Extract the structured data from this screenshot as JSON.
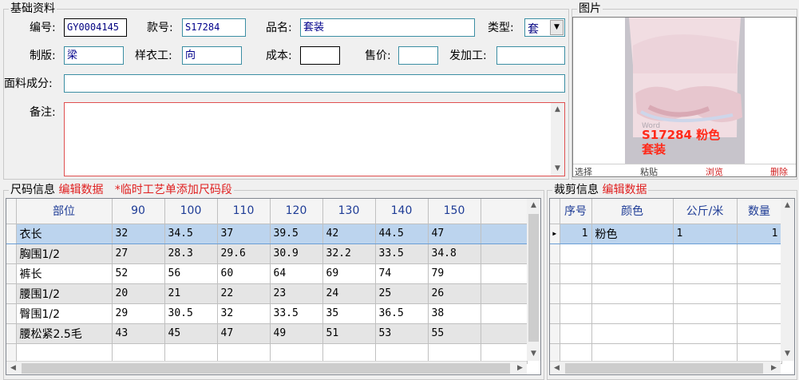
{
  "basic": {
    "title": "基础资料",
    "code_label": "编号:",
    "code_value": "GY0004145",
    "style_label": "款号:",
    "style_value": "S17284",
    "name_label": "品名:",
    "name_value": "套装",
    "type_label": "类型:",
    "type_value": "套",
    "pattern_label": "制版:",
    "pattern_value": "梁",
    "sample_label": "样衣工:",
    "sample_value": "向",
    "cost_label": "成本:",
    "cost_value": "",
    "price_label": "售价:",
    "price_value": "",
    "outsource_label": "发加工:",
    "outsource_value": "",
    "fabric_label": "面料成分:",
    "fabric_value": "",
    "notes_label": "备注:",
    "notes_value": ""
  },
  "picture": {
    "title": "图片",
    "caption_line1": "S17284  粉色",
    "caption_line2": "套装",
    "watermark": "Word",
    "btn_select": "选择",
    "btn_paste": "粘贴",
    "btn_browse": "浏览",
    "btn_delete": "删除"
  },
  "size_info": {
    "title": "尺码信息",
    "edit_link": "编辑数据",
    "add_link": "*临时工艺单添加尺码段",
    "headers": [
      "部位",
      "90",
      "100",
      "110",
      "120",
      "130",
      "140",
      "150"
    ],
    "rows": [
      [
        "衣长",
        "32",
        "34.5",
        "37",
        "39.5",
        "42",
        "44.5",
        "47"
      ],
      [
        "胸围1/2",
        "27",
        "28.3",
        "29.6",
        "30.9",
        "32.2",
        "33.5",
        "34.8"
      ],
      [
        "裤长",
        "52",
        "56",
        "60",
        "64",
        "69",
        "74",
        "79"
      ],
      [
        "腰围1/2",
        "20",
        "21",
        "22",
        "23",
        "24",
        "25",
        "26"
      ],
      [
        "臀围1/2",
        "29",
        "30.5",
        "32",
        "33.5",
        "35",
        "36.5",
        "38"
      ],
      [
        "腰松紧2.5毛",
        "43",
        "45",
        "47",
        "49",
        "51",
        "53",
        "55"
      ]
    ]
  },
  "cut_info": {
    "title": "裁剪信息",
    "edit_link": "编辑数据",
    "headers": [
      "序号",
      "颜色",
      "公斤/米",
      "数量"
    ],
    "rows": [
      [
        "1",
        "粉色",
        "1",
        "1"
      ]
    ]
  }
}
